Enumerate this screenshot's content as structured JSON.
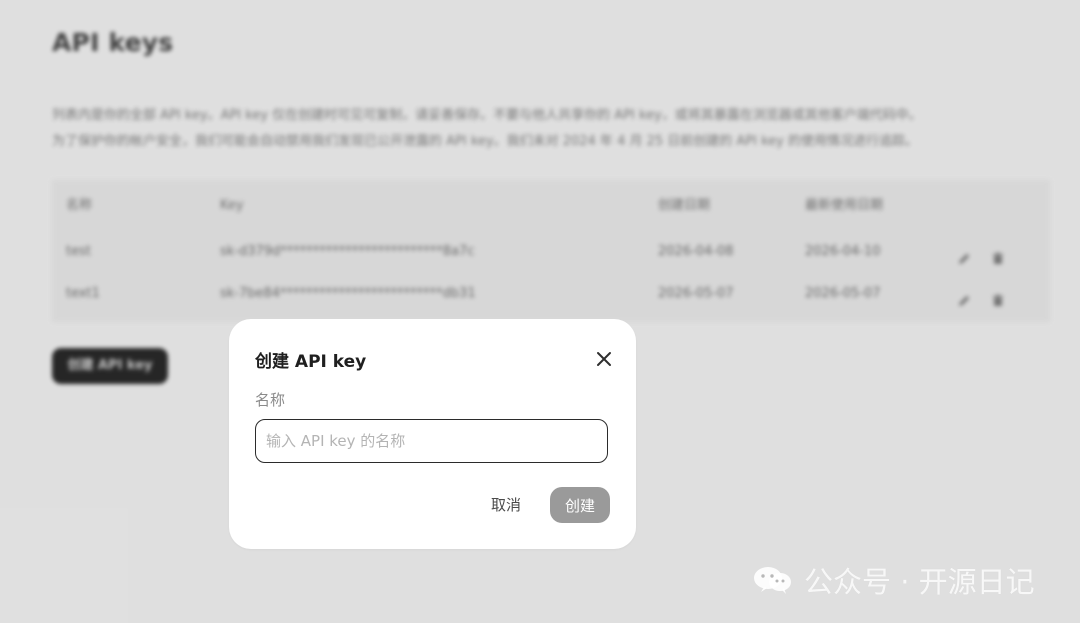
{
  "background": {
    "title": "API keys",
    "description_line_1": "列表内是你的全部 API key。API key 仅在创建时可见可复制，请妥善保存。不要与他人共享你的 API key，或将其暴露在浏览器或其他客户端代码中。",
    "description_line_2": "为了保护你的帐户安全，我们可能会自动禁用我们发现已公开泄露的 API key。我们未对 2024 年 4 月 25 日前创建的 API key 的使用情况进行追踪。",
    "table": {
      "headers": [
        "名称",
        "Key",
        "创建日期",
        "最新使用日期"
      ],
      "rows": [
        {
          "name": "test",
          "key": "sk-d379d*************************8a7c",
          "created": "2026-04-08",
          "last_used": "2026-04-10",
          "edit_icon": "pencil-icon",
          "delete_icon": "trash-icon"
        },
        {
          "name": "text1",
          "key": "sk-7be84*************************db31",
          "created": "2026-05-07",
          "last_used": "2026-05-07",
          "edit_icon": "pencil-icon",
          "delete_icon": "trash-icon"
        }
      ]
    },
    "create_button_label": "创建 API key"
  },
  "modal": {
    "title": "创建 API key",
    "close_icon": "close-icon",
    "name_label": "名称",
    "name_placeholder": "输入 API key 的名称",
    "name_value": "",
    "cancel_label": "取消",
    "create_label": "创建"
  },
  "watermark": {
    "icon": "wechat-icon",
    "text": "公众号 · 开源日记"
  },
  "colors": {
    "page_background": "#dedede",
    "modal_background": "#ffffff",
    "primary_disabled": "#9a9a9a",
    "input_border": "#2b2b2b",
    "background_button": "#111111"
  }
}
